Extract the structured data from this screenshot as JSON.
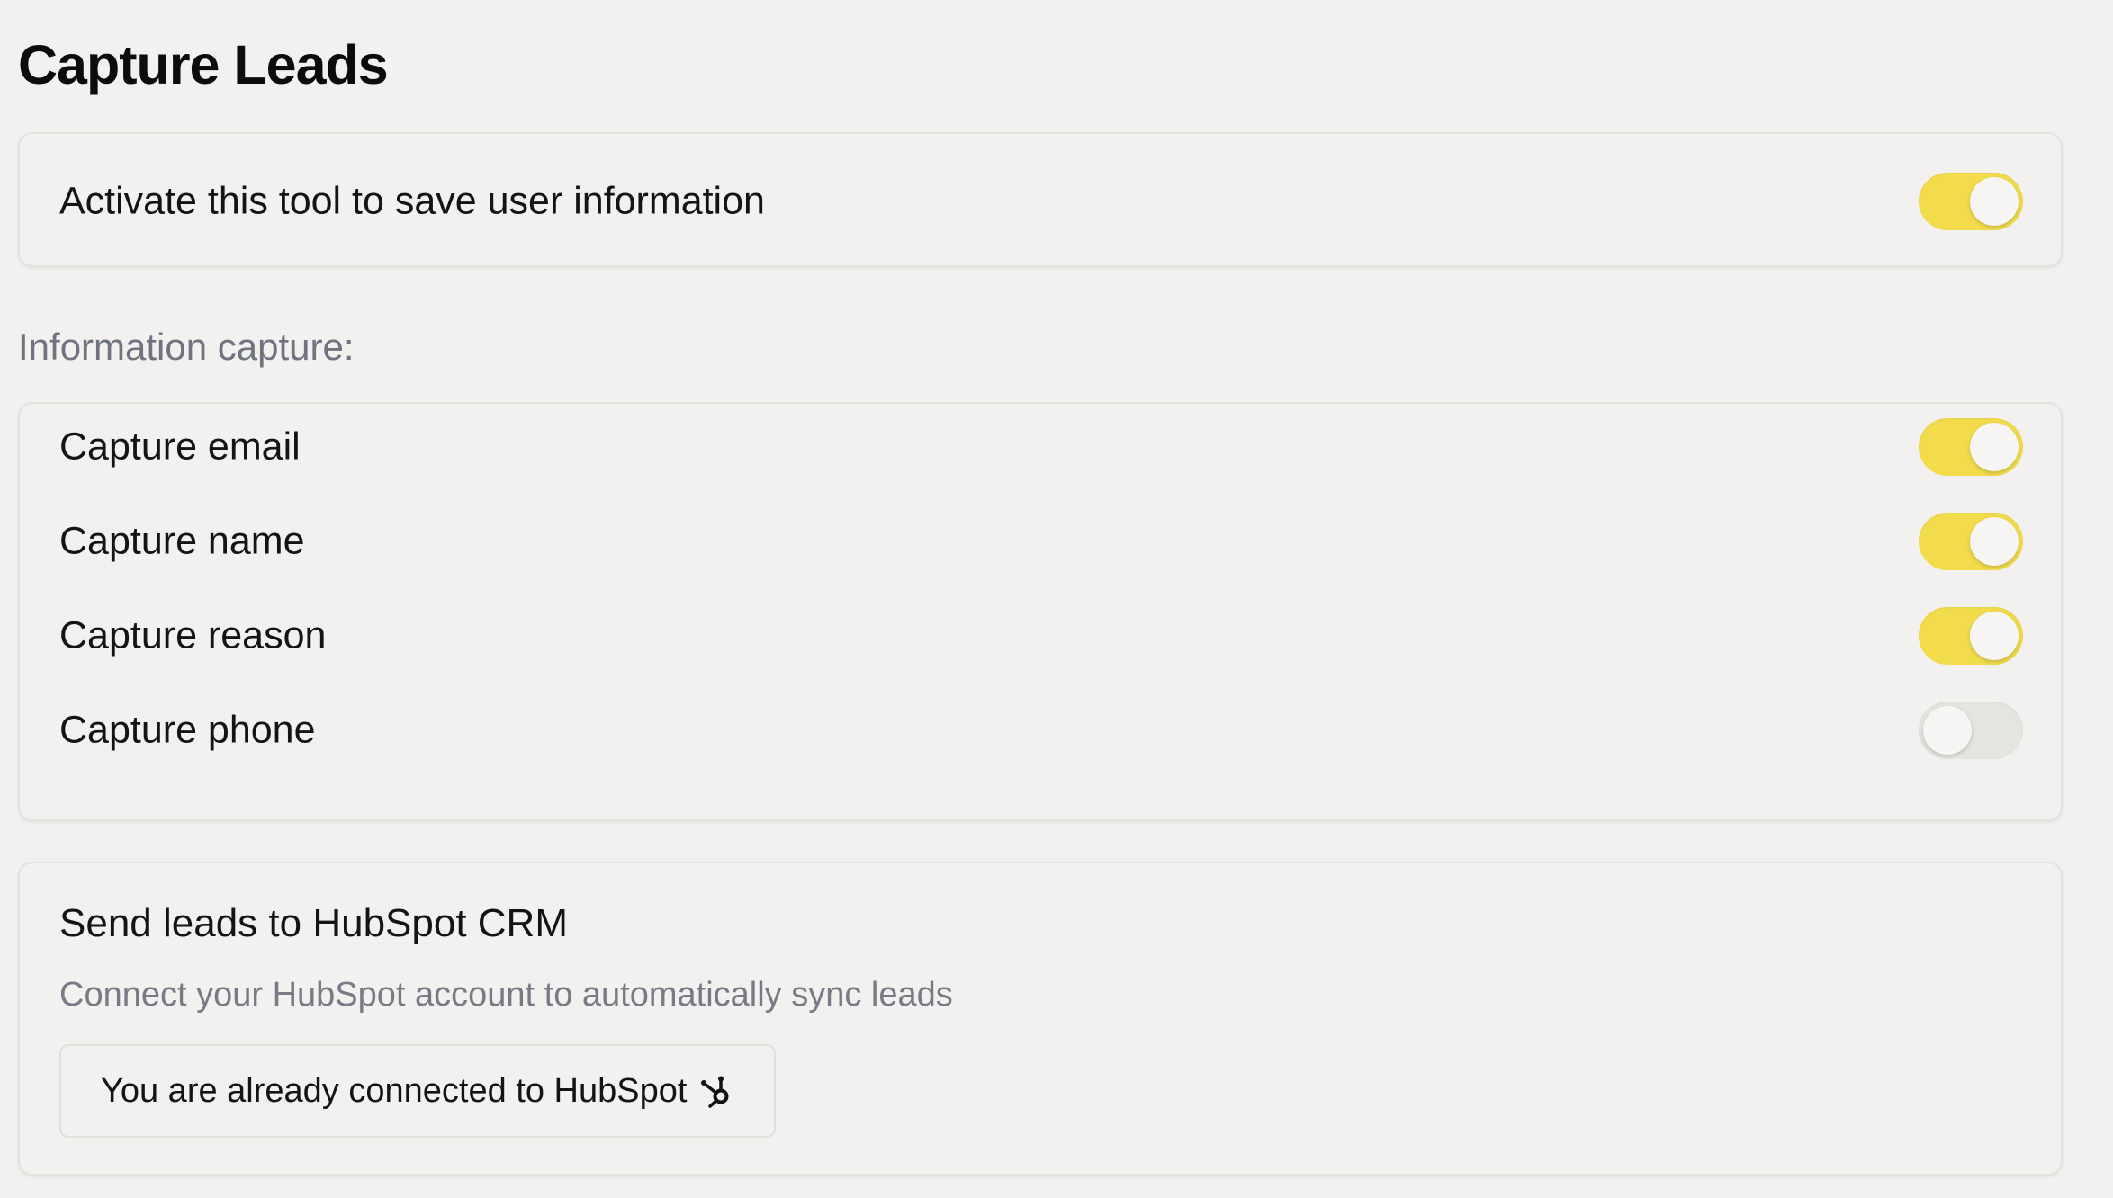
{
  "page": {
    "title": "Capture Leads"
  },
  "activate": {
    "label": "Activate this tool to save user information",
    "enabled": true
  },
  "capture": {
    "section_label": "Information capture:",
    "items": [
      {
        "label": "Capture email",
        "enabled": true
      },
      {
        "label": "Capture name",
        "enabled": true
      },
      {
        "label": "Capture reason",
        "enabled": true
      },
      {
        "label": "Capture phone",
        "enabled": false
      }
    ]
  },
  "hubspot": {
    "title": "Send leads to HubSpot CRM",
    "description": "Connect your HubSpot account to automatically sync leads",
    "button_label": "You are already connected to HubSpot",
    "button_icon": "hubspot-icon"
  },
  "colors": {
    "toggle_on": "#f2dc4c",
    "toggle_off": "#e5e4e1",
    "background": "#f2f1ef",
    "muted_text": "#6f7480"
  }
}
